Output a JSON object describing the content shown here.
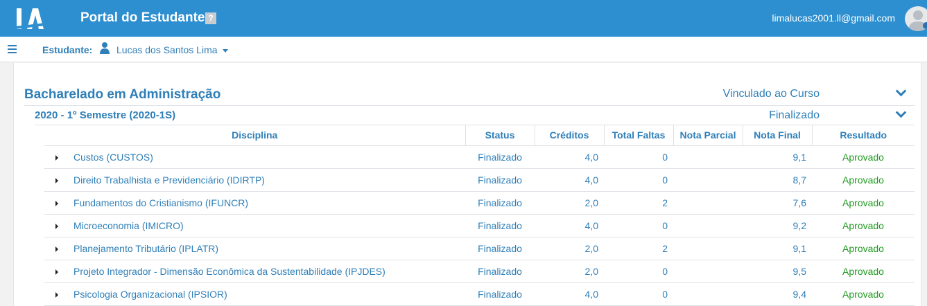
{
  "header": {
    "title": "Portal do Estudante",
    "help_glyph": "?",
    "email": "limalucas2001.ll@gmail.com",
    "colors": {
      "brand": "#2d8fd0",
      "text": "#2f7fb8",
      "approved": "#1f9a1f"
    }
  },
  "subheader": {
    "student_label": "Estudante:",
    "student_name": "Lucas dos Santos Lima"
  },
  "course": {
    "title": "Bacharelado em Administração",
    "status": "Vinculado ao Curso"
  },
  "semester": {
    "title": "2020 - 1º Semestre (2020-1S)",
    "status": "Finalizado"
  },
  "table": {
    "columns": [
      "Disciplina",
      "Status",
      "Créditos",
      "Total Faltas",
      "Nota Parcial",
      "Nota Final",
      "Resultado"
    ],
    "rows": [
      {
        "disciplina": "Custos (CUSTOS)",
        "status": "Finalizado",
        "creditos": "4,0",
        "faltas": "0",
        "parcial": "",
        "final": "9,1",
        "resultado": "Aprovado"
      },
      {
        "disciplina": "Direito Trabalhista e Previdenciário (IDIRTP)",
        "status": "Finalizado",
        "creditos": "4,0",
        "faltas": "0",
        "parcial": "",
        "final": "8,7",
        "resultado": "Aprovado"
      },
      {
        "disciplina": "Fundamentos do Cristianismo (IFUNCR)",
        "status": "Finalizado",
        "creditos": "2,0",
        "faltas": "2",
        "parcial": "",
        "final": "7,6",
        "resultado": "Aprovado"
      },
      {
        "disciplina": "Microeconomia (IMICRO)",
        "status": "Finalizado",
        "creditos": "4,0",
        "faltas": "0",
        "parcial": "",
        "final": "9,2",
        "resultado": "Aprovado"
      },
      {
        "disciplina": "Planejamento Tributário (IPLATR)",
        "status": "Finalizado",
        "creditos": "2,0",
        "faltas": "2",
        "parcial": "",
        "final": "9,1",
        "resultado": "Aprovado"
      },
      {
        "disciplina": "Projeto Integrador - Dimensão Econômica da Sustentabilidade (IPJDES)",
        "status": "Finalizado",
        "creditos": "2,0",
        "faltas": "0",
        "parcial": "",
        "final": "9,5",
        "resultado": "Aprovado"
      },
      {
        "disciplina": "Psicologia Organizacional (IPSIOR)",
        "status": "Finalizado",
        "creditos": "4,0",
        "faltas": "0",
        "parcial": "",
        "final": "9,4",
        "resultado": "Aprovado"
      }
    ]
  }
}
